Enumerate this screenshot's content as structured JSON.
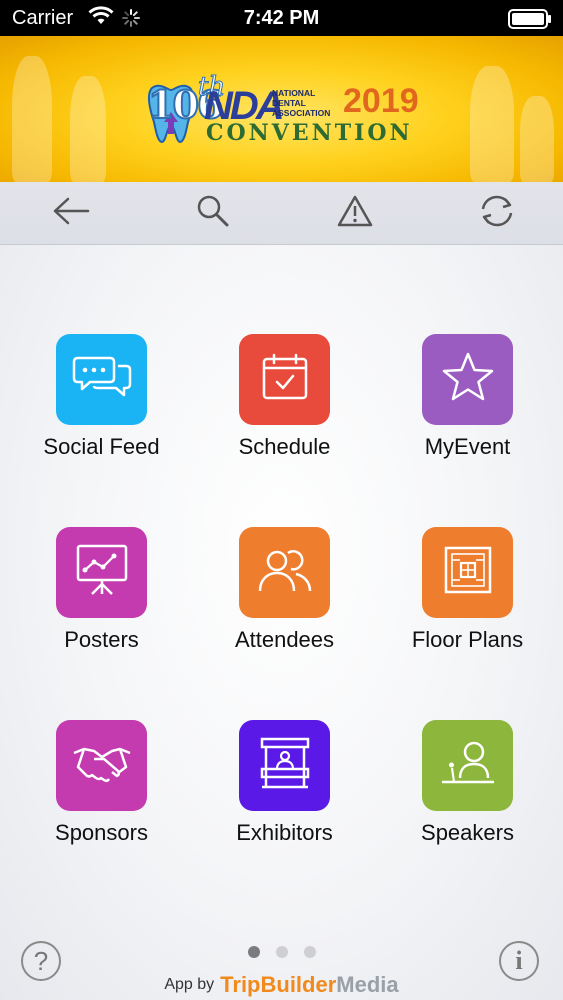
{
  "status_bar": {
    "carrier": "Carrier",
    "time": "7:42 PM"
  },
  "banner": {
    "edition_number": "106",
    "edition_suffix": "th",
    "org_abbrev": "NDA",
    "org_name": "NATIONAL DENTAL ASSOCIATION",
    "year": "2019",
    "event": "CONVENTION"
  },
  "toolbar": {
    "items": [
      {
        "name": "back",
        "icon": "arrow-left-icon"
      },
      {
        "name": "search",
        "icon": "search-icon"
      },
      {
        "name": "alerts",
        "icon": "warning-icon"
      },
      {
        "name": "refresh",
        "icon": "refresh-icon"
      }
    ]
  },
  "grid": {
    "tiles": [
      {
        "label": "Social Feed",
        "icon": "chat-bubbles-icon",
        "color": "#1ab3f3"
      },
      {
        "label": "Schedule",
        "icon": "calendar-check-icon",
        "color": "#e84b3c"
      },
      {
        "label": "MyEvent",
        "icon": "star-icon",
        "color": "#9b5cc2"
      },
      {
        "label": "Posters",
        "icon": "presentation-board-icon",
        "color": "#c43bb0"
      },
      {
        "label": "Attendees",
        "icon": "people-icon",
        "color": "#ef7d2e"
      },
      {
        "label": "Floor Plans",
        "icon": "floor-plan-icon",
        "color": "#ef7d2e"
      },
      {
        "label": "Sponsors",
        "icon": "handshake-icon",
        "color": "#c43bb0"
      },
      {
        "label": "Exhibitors",
        "icon": "booth-icon",
        "color": "#5a19e6"
      },
      {
        "label": "Speakers",
        "icon": "speaker-podium-icon",
        "color": "#8db63c"
      }
    ]
  },
  "footer": {
    "help_label": "?",
    "info_label": "i",
    "page_count": 3,
    "active_page": 1,
    "credit_prefix": "App by",
    "credit_brand_1": "TripBuilder",
    "credit_brand_2": "Media"
  }
}
